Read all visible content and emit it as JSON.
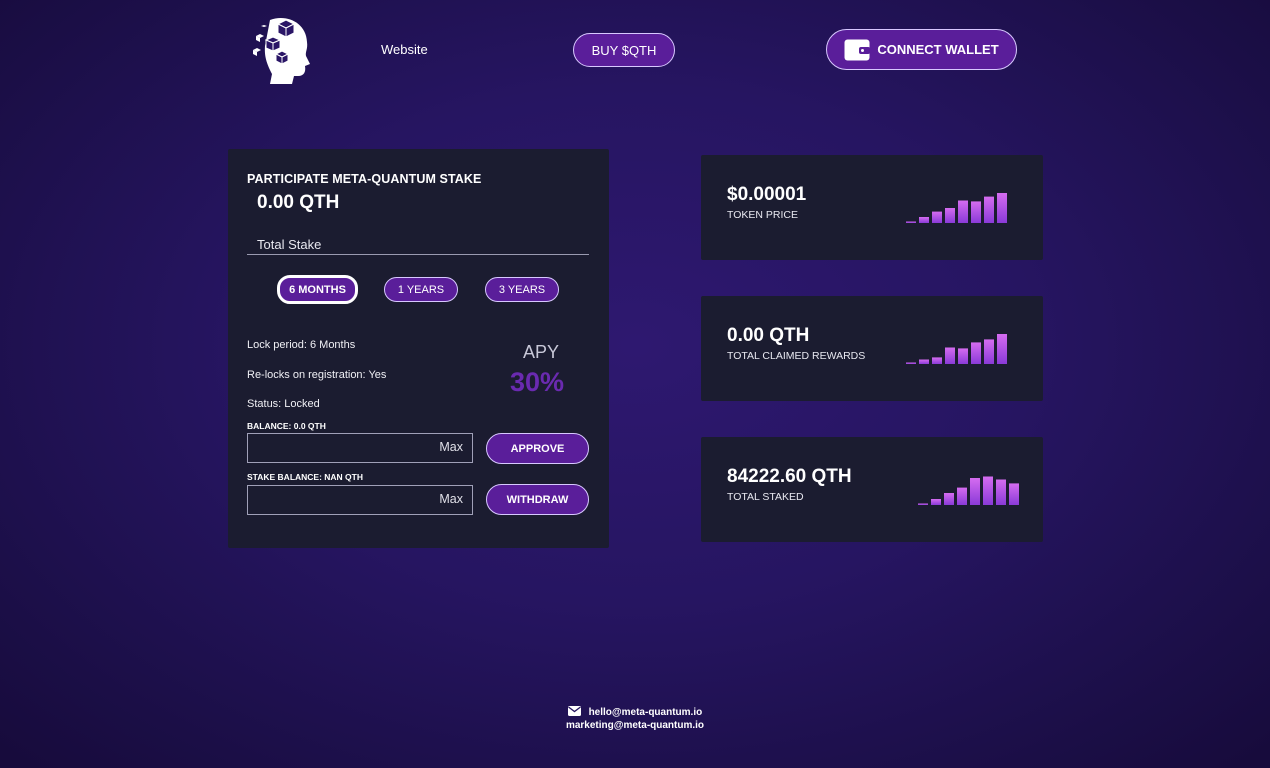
{
  "header": {
    "nav_link": "Website",
    "buy_label": "BUY $QTH",
    "connect_label": "CONNECT WALLET"
  },
  "stake": {
    "title": "PARTICIPATE META-QUANTUM STAKE",
    "amount": "0.00 QTH",
    "total_label": "Total Stake",
    "periods": [
      "6 MONTHS",
      "1 YEARS",
      "3 YEARS"
    ],
    "active_period": "6 MONTHS",
    "lock_period": "Lock period: 6 Months",
    "relocks": "Re-locks on registration: Yes",
    "status": "Status: Locked",
    "apy_label": "APY",
    "apy_value": "30%",
    "balance_label": "BALANCE: 0.0 QTH",
    "stake_balance_label": "STAKE BALANCE: NAN QTH",
    "max_label": "Max",
    "approve_label": "APPROVE",
    "withdraw_label": "WITHDRAW"
  },
  "stats": [
    {
      "value": "$0.00001",
      "label": "TOKEN PRICE",
      "bars": [
        0.05,
        0.2,
        0.38,
        0.5,
        0.75,
        0.72,
        0.88,
        1.0
      ]
    },
    {
      "value": "0.00 QTH",
      "label": "TOTAL CLAIMED REWARDS",
      "bars": [
        0.05,
        0.15,
        0.22,
        0.55,
        0.52,
        0.72,
        0.82,
        1.0
      ]
    },
    {
      "value": "84222.60 QTH",
      "label": "TOTAL STAKED",
      "bars": [
        0.05,
        0.2,
        0.4,
        0.58,
        0.9,
        0.95,
        0.85,
        0.72
      ]
    }
  ],
  "footer": {
    "email1": "hello@meta-quantum.io",
    "email2": "marketing@meta-quantum.io"
  },
  "colors": {
    "accent": "#5a1e9a",
    "apy": "#6a2ab0",
    "card_bg": "#1b1c30",
    "bar_top": "#d56cf0",
    "bar_bottom": "#8a3ad8"
  }
}
